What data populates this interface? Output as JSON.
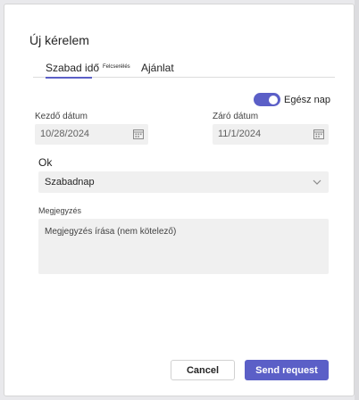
{
  "dialog": {
    "title": "Új kérelem",
    "tabs": {
      "active": "Szabad idő",
      "small": "Felcserélés",
      "offer": "Ajánlat"
    },
    "toggle": {
      "label": "Egész nap",
      "on": true
    },
    "start": {
      "label": "Kezdő dátum",
      "value": "10/28/2024"
    },
    "end": {
      "label": "Záró dátum",
      "value": "11/1/2024"
    },
    "reason": {
      "label": "Ok",
      "value": "Szabadnap"
    },
    "notes": {
      "label": "Megjegyzés",
      "placeholder": "Megjegyzés írása (nem kötelező)"
    },
    "buttons": {
      "cancel": "Cancel",
      "send": "Send request"
    }
  },
  "colors": {
    "accent": "#5b5fc7",
    "field_bg": "#f0f0f0"
  },
  "icons": {
    "calendar": "calendar-icon",
    "dropdown": "chevron-down-icon"
  }
}
